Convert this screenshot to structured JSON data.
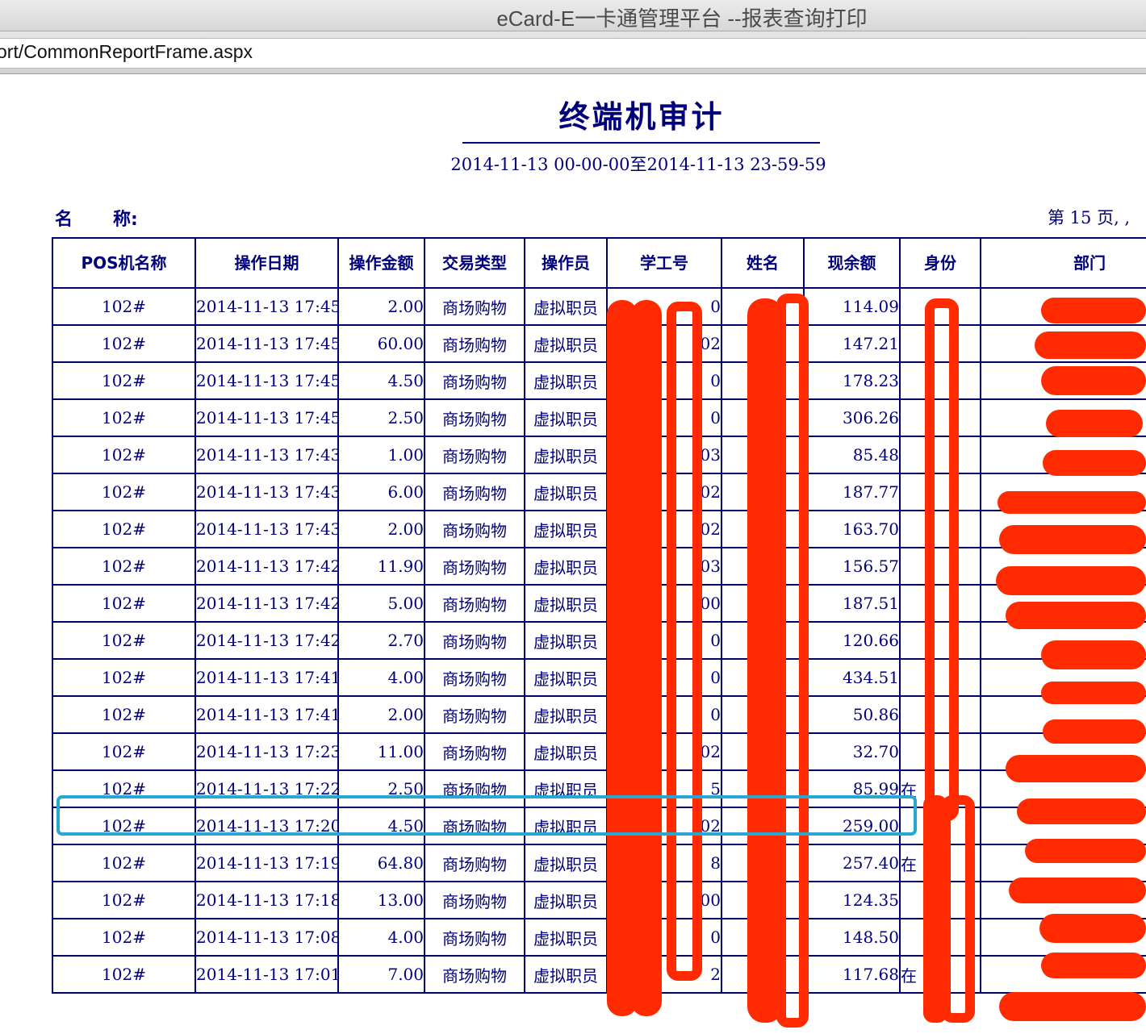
{
  "window": {
    "title": "eCard-E一卡通管理平台 --报表查询打印"
  },
  "address_bar": {
    "url": "ort/CommonReportFrame.aspx"
  },
  "report": {
    "title": "终端机审计",
    "date_range": "2014-11-13 00-00-00至2014-11-13 23-59-59",
    "name_label_a": "名",
    "name_label_b": "称:",
    "page_info": "第 15 页, ,"
  },
  "table": {
    "columns": [
      "POS机名称",
      "操作日期",
      "操作金额",
      "交易类型",
      "操作员",
      "学工号",
      "姓名",
      "现余额",
      "身份",
      "部门"
    ],
    "rows": [
      {
        "pos": "102#",
        "date": "2014-11-13 17:45",
        "amount": "2.00",
        "type": "商场购物",
        "operator": "虚拟职员",
        "id": "0",
        "name": "",
        "balance": "114.09",
        "role": "",
        "dept": ""
      },
      {
        "pos": "102#",
        "date": "2014-11-13 17:45",
        "amount": "60.00",
        "type": "商场购物",
        "operator": "虚拟职员",
        "id": "02",
        "name": "",
        "balance": "147.21",
        "role": "",
        "dept": ""
      },
      {
        "pos": "102#",
        "date": "2014-11-13 17:45",
        "amount": "4.50",
        "type": "商场购物",
        "operator": "虚拟职员",
        "id": "0",
        "name": "",
        "balance": "178.23",
        "role": "",
        "dept": ""
      },
      {
        "pos": "102#",
        "date": "2014-11-13 17:45",
        "amount": "2.50",
        "type": "商场购物",
        "operator": "虚拟职员",
        "id": "0",
        "name": "",
        "balance": "306.26",
        "role": "",
        "dept": ""
      },
      {
        "pos": "102#",
        "date": "2014-11-13 17:43",
        "amount": "1.00",
        "type": "商场购物",
        "operator": "虚拟职员",
        "id": "03",
        "name": "",
        "balance": "85.48",
        "role": "",
        "dept": ""
      },
      {
        "pos": "102#",
        "date": "2014-11-13 17:43",
        "amount": "6.00",
        "type": "商场购物",
        "operator": "虚拟职员",
        "id": "02",
        "name": "",
        "balance": "187.77",
        "role": "",
        "dept": ""
      },
      {
        "pos": "102#",
        "date": "2014-11-13 17:43",
        "amount": "2.00",
        "type": "商场购物",
        "operator": "虚拟职员",
        "id": "02",
        "name": "",
        "balance": "163.70",
        "role": "",
        "dept": ""
      },
      {
        "pos": "102#",
        "date": "2014-11-13 17:42",
        "amount": "11.90",
        "type": "商场购物",
        "operator": "虚拟职员",
        "id": "03",
        "name": "",
        "balance": "156.57",
        "role": "",
        "dept": ""
      },
      {
        "pos": "102#",
        "date": "2014-11-13 17:42",
        "amount": "5.00",
        "type": "商场购物",
        "operator": "虚拟职员",
        "id": "00",
        "name": "",
        "balance": "187.51",
        "role": "",
        "dept": ""
      },
      {
        "pos": "102#",
        "date": "2014-11-13 17:42",
        "amount": "2.70",
        "type": "商场购物",
        "operator": "虚拟职员",
        "id": "0",
        "name": "",
        "balance": "120.66",
        "role": "",
        "dept": ""
      },
      {
        "pos": "102#",
        "date": "2014-11-13 17:41",
        "amount": "4.00",
        "type": "商场购物",
        "operator": "虚拟职员",
        "id": "0",
        "name": "",
        "balance": "434.51",
        "role": "",
        "dept": ""
      },
      {
        "pos": "102#",
        "date": "2014-11-13 17:41",
        "amount": "2.00",
        "type": "商场购物",
        "operator": "虚拟职员",
        "id": "0",
        "name": "",
        "balance": "50.86",
        "role": "",
        "dept": ""
      },
      {
        "pos": "102#",
        "date": "2014-11-13 17:23",
        "amount": "11.00",
        "type": "商场购物",
        "operator": "虚拟职员",
        "id": "02",
        "name": "",
        "balance": "32.70",
        "role": "",
        "dept": ""
      },
      {
        "pos": "102#",
        "date": "2014-11-13 17:22",
        "amount": "2.50",
        "type": "商场购物",
        "operator": "虚拟职员",
        "id": "5",
        "name": "",
        "balance": "85.99",
        "role": "在",
        "dept": ""
      },
      {
        "pos": "102#",
        "date": "2014-11-13 17:20",
        "amount": "4.50",
        "type": "商场购物",
        "operator": "虚拟职员",
        "id": "02",
        "name": "",
        "balance": "259.00",
        "role": "",
        "dept": ""
      },
      {
        "pos": "102#",
        "date": "2014-11-13 17:19",
        "amount": "64.80",
        "type": "商场购物",
        "operator": "虚拟职员",
        "id": "8",
        "name": "",
        "balance": "257.40",
        "role": "在",
        "dept": ""
      },
      {
        "pos": "102#",
        "date": "2014-11-13 17:18",
        "amount": "13.00",
        "type": "商场购物",
        "operator": "虚拟职员",
        "id": "00",
        "name": "",
        "balance": "124.35",
        "role": "",
        "dept": ""
      },
      {
        "pos": "102#",
        "date": "2014-11-13 17:08",
        "amount": "4.00",
        "type": "商场购物",
        "operator": "虚拟职员",
        "id": "0",
        "name": "",
        "balance": "148.50",
        "role": "",
        "dept": ""
      },
      {
        "pos": "102#",
        "date": "2014-11-13 17:01",
        "amount": "7.00",
        "type": "商场购物",
        "operator": "虚拟职员",
        "id": "2",
        "name": "",
        "balance": "117.68",
        "role": "在",
        "dept": ""
      }
    ]
  },
  "annotation": {
    "highlight_row": 13,
    "highlight_color": "#2aa6d2",
    "redaction_color": "#ff2a00"
  }
}
